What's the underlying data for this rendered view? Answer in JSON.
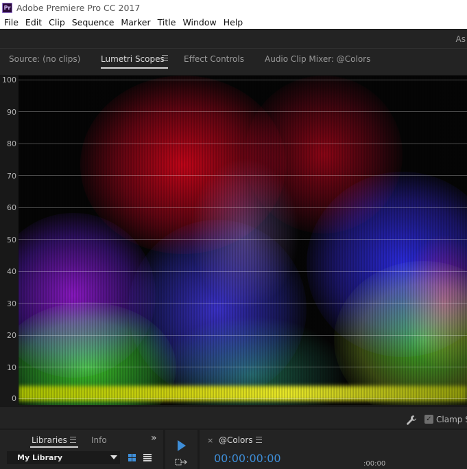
{
  "window": {
    "app_icon": "Pr",
    "title": "Adobe Premiere Pro CC 2017"
  },
  "menu": [
    "File",
    "Edit",
    "Clip",
    "Sequence",
    "Marker",
    "Title",
    "Window",
    "Help"
  ],
  "workspace": {
    "label": "As"
  },
  "top_panel": {
    "tabs": [
      {
        "label": "Source: (no clips)",
        "active": false
      },
      {
        "label": "Lumetri Scopes",
        "active": true
      },
      {
        "label": "Effect Controls",
        "active": false
      },
      {
        "label": "Audio Clip Mixer: @Colors",
        "active": false
      }
    ],
    "scope": {
      "y_ticks": [
        "100",
        "90",
        "80",
        "70",
        "60",
        "50",
        "40",
        "30",
        "20",
        "10",
        "0"
      ]
    },
    "clamp_label": "Clamp Si",
    "clamp_checked": true
  },
  "bottom": {
    "libraries_tab": "Libraries",
    "info_tab": "Info",
    "overflow": "»",
    "library_select": "My Library",
    "timeline_close": "×",
    "timeline_tab": "@Colors",
    "timecode": "00:00:00:00",
    "ruler_time": ":00:00"
  },
  "colors": {
    "accent_blue": "#3e8ed8",
    "panel_bg": "#232323"
  },
  "icons": [
    "app-icon",
    "hamburger-icon",
    "wrench-icon",
    "checkbox-icon",
    "grid-view-icon",
    "list-view-icon",
    "play-icon",
    "track-select-icon",
    "close-icon"
  ]
}
